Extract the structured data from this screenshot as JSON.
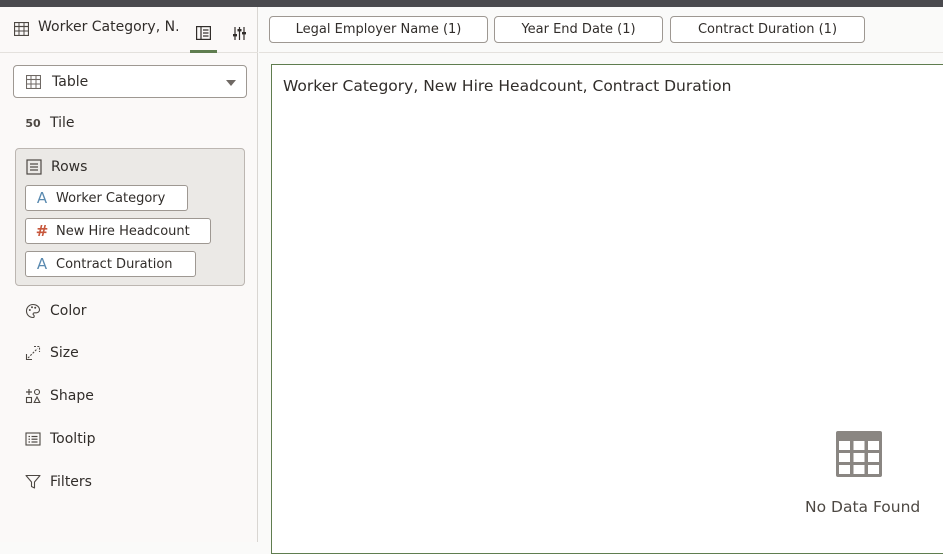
{
  "header": {
    "title": "Worker Category, N...",
    "tab_visualize_icon": "layout-panel-icon",
    "tab_properties_icon": "sliders-icon"
  },
  "visualization": {
    "type_label": "Table",
    "type_icon": "table-icon"
  },
  "grammar": {
    "tile": "Tile",
    "rows": "Rows",
    "color": "Color",
    "size": "Size",
    "shape": "Shape",
    "tooltip": "Tooltip",
    "filters": "Filters"
  },
  "rows_items": [
    {
      "label": "Worker Category",
      "kind": "attribute",
      "icon": "A"
    },
    {
      "label": "New Hire Headcount",
      "kind": "measure",
      "icon": "#"
    },
    {
      "label": "Contract Duration",
      "kind": "attribute",
      "icon": "A"
    }
  ],
  "filters_bar": [
    "Legal Employer Name (1)",
    "Year End Date (1)",
    "Contract Duration (1)"
  ],
  "canvas": {
    "title": "Worker Category, New Hire Headcount, Contract Duration",
    "empty_message": "No Data Found"
  },
  "colors": {
    "accent_green": "#5f7d4f",
    "attribute_blue": "#5a8ab0",
    "measure_red": "#c7573c",
    "topbar": "#4a4a4e"
  }
}
